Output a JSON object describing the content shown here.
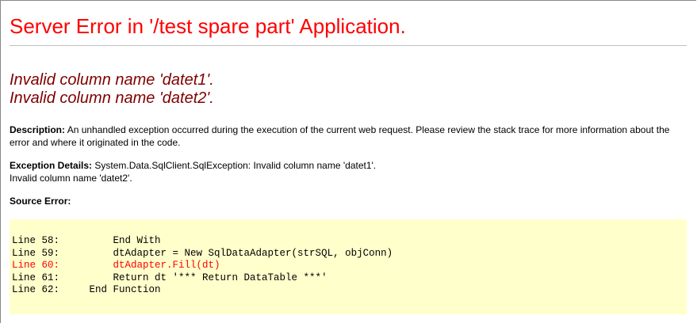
{
  "title": "Server Error in '/test spare part' Application.",
  "error_lines": [
    "Invalid column name 'datet1'.",
    "Invalid column name 'datet2'."
  ],
  "description": {
    "label": "Description:",
    "text": "An unhandled exception occurred during the execution of the current web request. Please review the stack trace for more information about the error and where it originated in the code."
  },
  "exception": {
    "label": "Exception Details:",
    "line1": "System.Data.SqlClient.SqlException: Invalid column name 'datet1'.",
    "line2": "Invalid column name 'datet2'."
  },
  "source_error_label": "Source Error:",
  "source_lines": [
    {
      "text": "Line 58:         End With",
      "highlight": false
    },
    {
      "text": "Line 59:         dtAdapter = New SqlDataAdapter(strSQL, objConn)",
      "highlight": false
    },
    {
      "text": "Line 60:         dtAdapter.Fill(dt)",
      "highlight": true
    },
    {
      "text": "Line 61:         Return dt '*** Return DataTable ***'",
      "highlight": false
    },
    {
      "text": "Line 62:     End Function",
      "highlight": false
    }
  ],
  "colors": {
    "title": "#ff0000",
    "error": "#800000",
    "code_bg": "#ffffcc",
    "highlight": "#ff0000"
  }
}
